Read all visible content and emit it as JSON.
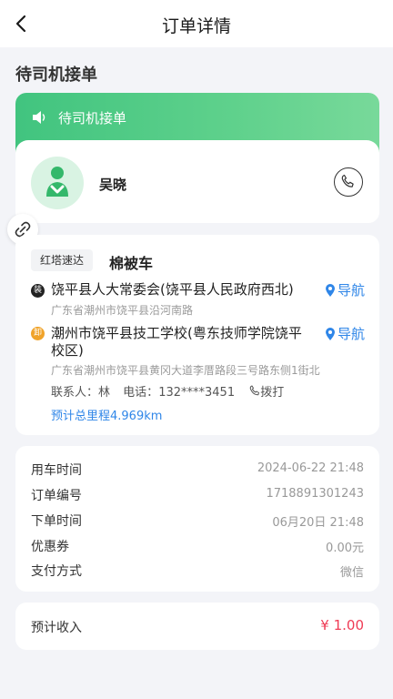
{
  "header": {
    "title": "订单详情"
  },
  "status": {
    "title": "待司机接单",
    "banner_text": "待司机接单"
  },
  "driver": {
    "name": "吴晓"
  },
  "order": {
    "company_tag": "红塔速达",
    "goods_name": "棉被车",
    "load": {
      "pin_label": "装",
      "name": "饶平县人大常委会(饶平县人民政府西北)",
      "detail": "广东省潮州市饶平县沿河南路",
      "nav_label": "导航"
    },
    "unload": {
      "pin_label": "卸",
      "name": "潮州市饶平县技工学校(粤东技师学院饶平校区)",
      "detail": "广东省潮州市饶平县黄冈大道李厝路段三号路东侧1街北",
      "nav_label": "导航"
    },
    "contact": {
      "label": "联系人：",
      "name": "林",
      "phone_label": "电话：",
      "phone": "132****3451",
      "call_label": "拨打"
    },
    "mileage": "预计总里程4.969km"
  },
  "info": {
    "use_time": {
      "label": "用车时间",
      "value": "2024-06-22 21:48"
    },
    "order_no": {
      "label": "订单编号",
      "value": "1718891301243"
    },
    "order_time": {
      "label": "下单时间",
      "value": "06月20日 21:48"
    },
    "coupon": {
      "label": "优惠券",
      "value": "0.00元"
    },
    "payment": {
      "label": "支付方式",
      "value": "微信"
    }
  },
  "income": {
    "label": "预计收入",
    "value": "¥ 1.00"
  },
  "colors": {
    "accent_green": "#41c47f",
    "link_blue": "#2f86e8",
    "price_red": "#ef3b55",
    "unload_orange": "#f0a32a"
  },
  "icons": {
    "back": "chevron-left-icon",
    "speaker": "speaker-icon",
    "avatar": "driver-avatar-icon",
    "phone": "phone-icon",
    "link": "link-icon",
    "navigation": "location-pin-icon"
  }
}
